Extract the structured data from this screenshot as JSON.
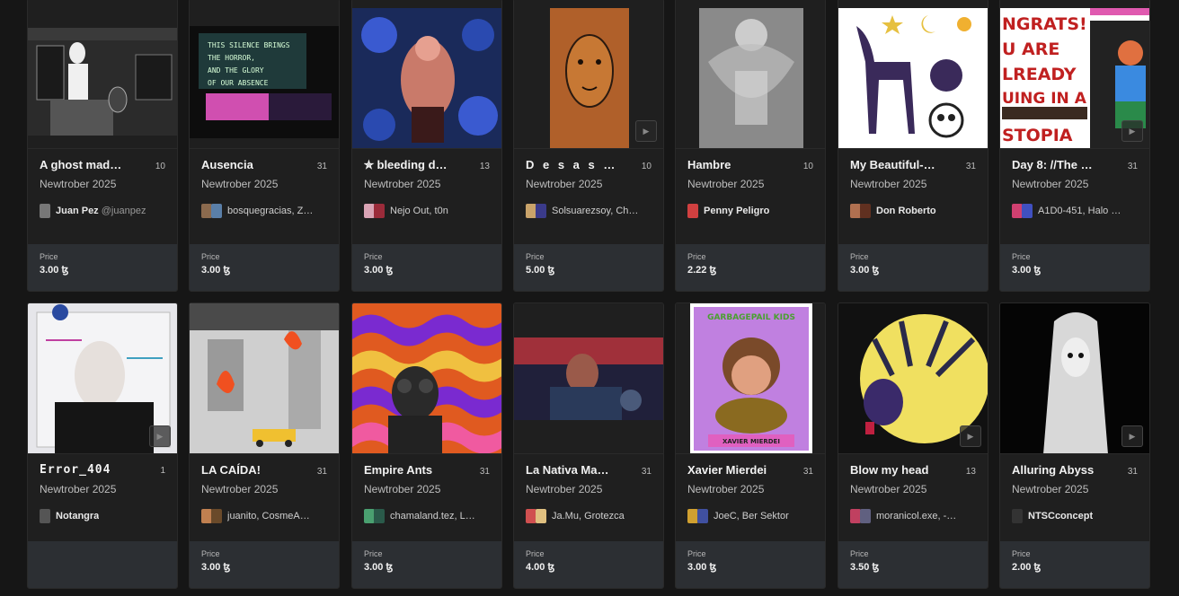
{
  "row1": [
    {
      "title": "A ghost mad…",
      "count": "10",
      "collection": "Newtrober 2025",
      "artists": "Juan Pez",
      "handle": "@juanpez",
      "price_label": "Price",
      "price": "3.00 ꜩ",
      "avatars": [
        "#777777",
        "#444444"
      ]
    },
    {
      "title": "Ausencia",
      "count": "31",
      "collection": "Newtrober 2025",
      "artists": "bosquegracias, Z…",
      "handle": "",
      "price_label": "Price",
      "price": "3.00 ꜩ",
      "avatars": [
        "#8b6a4e",
        "#5a7fa8"
      ]
    },
    {
      "title": "✮ bleeding d…",
      "count": "13",
      "collection": "Newtrober 2025",
      "artists": "Nejo Out, t0n",
      "handle": "",
      "price_label": "Price",
      "price": "3.00 ꜩ",
      "avatars": [
        "#d9a3b4",
        "#9b2b3a"
      ]
    },
    {
      "title": "D e s a s …",
      "count": "10",
      "collection": "Newtrober 2025",
      "artists": "Solsuarezsoy, Ch…",
      "handle": "",
      "price_label": "Price",
      "price": "5.00 ꜩ",
      "avatars": [
        "#c9a36a",
        "#3a3a8a"
      ]
    },
    {
      "title": "Hambre",
      "count": "10",
      "collection": "Newtrober 2025",
      "artists": "Penny Peligro",
      "handle": "",
      "price_label": "Price",
      "price": "2.22 ꜩ",
      "avatars": [
        "#d04040",
        "#e08080"
      ]
    },
    {
      "title": "My Beautiful-…",
      "count": "31",
      "collection": "Newtrober 2025",
      "artists": "Don Roberto",
      "handle": "",
      "price_label": "Price",
      "price": "3.00 ꜩ",
      "avatars": [
        "#b07050",
        "#603020"
      ]
    },
    {
      "title": "Day 8: //The …",
      "count": "31",
      "collection": "Newtrober 2025",
      "artists": "A1D0-451, Halo …",
      "handle": "",
      "price_label": "Price",
      "price": "3.00 ꜩ",
      "avatars": [
        "#d04070",
        "#4050c0"
      ]
    }
  ],
  "row2": [
    {
      "title": "Error_404",
      "count": "1",
      "collection": "Newtrober 2025",
      "artists": "Notangra",
      "handle": "",
      "price_label": "",
      "price": "",
      "avatars": [
        "#555555",
        "#888888"
      ]
    },
    {
      "title": "LA CAÍDA!",
      "count": "31",
      "collection": "Newtrober 2025",
      "artists": "juanito, CosmeA…",
      "handle": "",
      "price_label": "Price",
      "price": "3.00 ꜩ",
      "avatars": [
        "#c08050",
        "#6a4a2a"
      ]
    },
    {
      "title": "Empire Ants",
      "count": "31",
      "collection": "Newtrober 2025",
      "artists": "chamaland.tez, L…",
      "handle": "",
      "price_label": "Price",
      "price": "3.00 ꜩ",
      "avatars": [
        "#4aa070",
        "#2a5a4a"
      ]
    },
    {
      "title": "La Nativa Ma…",
      "count": "31",
      "collection": "Newtrober 2025",
      "artists": "Ja.Mu, Grotezca",
      "handle": "",
      "price_label": "Price",
      "price": "4.00 ꜩ",
      "avatars": [
        "#d05050",
        "#e0c080"
      ]
    },
    {
      "title": "Xavier Mierdei",
      "count": "31",
      "collection": "Newtrober 2025",
      "artists": "JoeC, Ber Sektor",
      "handle": "",
      "price_label": "Price",
      "price": "3.00 ꜩ",
      "avatars": [
        "#d0a030",
        "#4050a0"
      ]
    },
    {
      "title": "Blow my head",
      "count": "13",
      "collection": "Newtrober 2025",
      "artists": "moranicol.exe, -…",
      "handle": "",
      "price_label": "Price",
      "price": "3.50 ꜩ",
      "avatars": [
        "#c04060",
        "#606080"
      ]
    },
    {
      "title": "Alluring Abyss",
      "count": "31",
      "collection": "Newtrober 2025",
      "artists": "NTSCconcept",
      "handle": "",
      "price_label": "Price",
      "price": "2.00 ꜩ",
      "avatars": [
        "#333333",
        "#777777"
      ]
    }
  ],
  "icons": {
    "play": "play-icon"
  },
  "art_text": {
    "ausencia": "THIS SILENCE BRINGS\nTHE HORROR,\nAND THE GLORY\nOF OUR ABSENCE",
    "day8": "NGRATS!\nU ARE\nLREADY\nUING IN A\nSTOPIA",
    "xavier_top": "GARBAGEPAIL KIDS",
    "xavier_bottom": "XAVIER MIERDEI"
  }
}
